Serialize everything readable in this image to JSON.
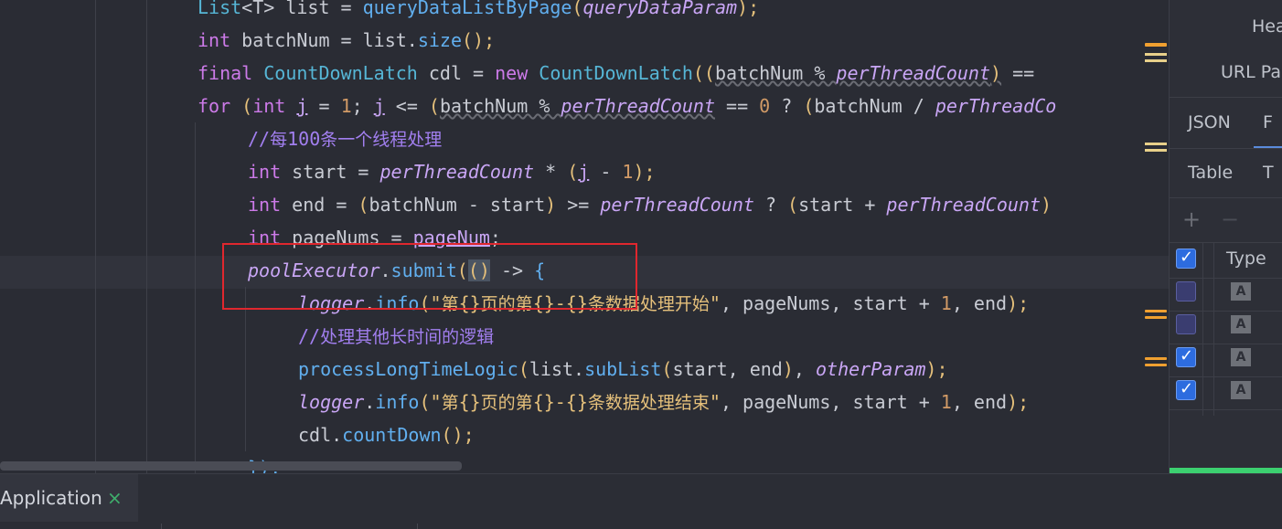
{
  "editor": {
    "lines": [
      {
        "id": "l1",
        "tokens": [
          [
            "ty",
            "List"
          ],
          [
            "vr",
            "<T> list = "
          ],
          [
            "fn",
            "queryDataListByPage"
          ],
          [
            "str",
            "("
          ],
          [
            "fld",
            "queryDataParam"
          ],
          [
            "str",
            ");"
          ]
        ]
      },
      {
        "id": "l2",
        "tokens": [
          [
            "kw",
            "int"
          ],
          [
            "vr",
            " batchNum = list."
          ],
          [
            "fn",
            "size"
          ],
          [
            "str",
            "();"
          ]
        ]
      },
      {
        "id": "l3",
        "tokens": [
          [
            "kw",
            "final "
          ],
          [
            "ty",
            "CountDownLatch"
          ],
          [
            "vr",
            " cdl = "
          ],
          [
            "kw",
            "new "
          ],
          [
            "ty",
            "CountDownLatch"
          ],
          [
            "str",
            "(("
          ],
          [
            "vr",
            "batchNum % "
          ],
          [
            "fld",
            "perThreadCount"
          ],
          [
            "str",
            ")"
          ],
          [
            "vr",
            " == "
          ]
        ]
      },
      {
        "id": "l4",
        "tokens": [
          [
            "kw",
            "for "
          ],
          [
            "str",
            "("
          ],
          [
            "kw",
            "int "
          ],
          [
            "fldu",
            "j"
          ],
          [
            "vr",
            " = "
          ],
          [
            "num",
            "1"
          ],
          [
            "vr",
            "; "
          ],
          [
            "fldu",
            "j"
          ],
          [
            "vr",
            " <= "
          ],
          [
            "str",
            "("
          ],
          [
            "vr",
            "batchNum % "
          ],
          [
            "fld",
            "perThreadCount"
          ],
          [
            "vr",
            " == "
          ],
          [
            "num",
            "0"
          ],
          [
            "vr",
            " ? "
          ],
          [
            "str",
            "("
          ],
          [
            "vr",
            "batchNum / "
          ],
          [
            "fld",
            "perThreadCo"
          ]
        ]
      },
      {
        "id": "l5",
        "tokens": [
          [
            "cm",
            "//"
          ],
          [
            "cmcn",
            "每"
          ],
          [
            "cm",
            "100"
          ],
          [
            "cmcn",
            "条一个线程处理"
          ]
        ]
      },
      {
        "id": "l6",
        "tokens": [
          [
            "kw",
            "int"
          ],
          [
            "vr",
            " start = "
          ],
          [
            "fld",
            "perThreadCount"
          ],
          [
            "vr",
            " * "
          ],
          [
            "str",
            "("
          ],
          [
            "fldu",
            "j"
          ],
          [
            "vr",
            " - "
          ],
          [
            "num",
            "1"
          ],
          [
            "str",
            ");"
          ]
        ]
      },
      {
        "id": "l7",
        "tokens": [
          [
            "kw",
            "int"
          ],
          [
            "vr",
            " end = "
          ],
          [
            "str",
            "("
          ],
          [
            "vr",
            "batchNum - start"
          ],
          [
            "str",
            ")"
          ],
          [
            "vr",
            " >= "
          ],
          [
            "fld",
            "perThreadCount"
          ],
          [
            "vr",
            " ? "
          ],
          [
            "str",
            "("
          ],
          [
            "vr",
            "start + "
          ],
          [
            "fld",
            "perThreadCount"
          ],
          [
            "str",
            ")"
          ]
        ]
      },
      {
        "id": "l8",
        "tokens": [
          [
            "kw",
            "int"
          ],
          [
            "vr",
            " pageNums = "
          ],
          [
            "fldu",
            "pageNum"
          ],
          [
            "vr",
            ";"
          ]
        ]
      },
      {
        "id": "l9",
        "tokens": [
          [
            "fld",
            "poolExecutor"
          ],
          [
            "vr",
            "."
          ],
          [
            "fn",
            "submit"
          ],
          [
            "str",
            "("
          ],
          [
            "phl",
            "()"
          ],
          [
            "vr",
            " -> "
          ],
          [
            "fn",
            "{"
          ]
        ]
      },
      {
        "id": "l10",
        "tokens": [
          [
            "fld",
            "logger"
          ],
          [
            "vr",
            "."
          ],
          [
            "fn",
            "info"
          ],
          [
            "str",
            "("
          ],
          [
            "str",
            "\"第{}页的第{}-{}条数据处理开始\""
          ],
          [
            "vr",
            ", pageNums, start + "
          ],
          [
            "num",
            "1"
          ],
          [
            "vr",
            ", end"
          ],
          [
            "str",
            ");"
          ]
        ]
      },
      {
        "id": "l11",
        "tokens": [
          [
            "cm",
            "//"
          ],
          [
            "cmcn",
            "处理其他长时间的逻辑"
          ]
        ]
      },
      {
        "id": "l12",
        "tokens": [
          [
            "fn",
            "processLongTimeLogic"
          ],
          [
            "str",
            "("
          ],
          [
            "vr",
            "list."
          ],
          [
            "fn",
            "subList"
          ],
          [
            "str",
            "("
          ],
          [
            "vr",
            "start, end"
          ],
          [
            "str",
            ")"
          ],
          [
            "vr",
            ", "
          ],
          [
            "fld",
            "otherParam"
          ],
          [
            "str",
            ");"
          ]
        ]
      },
      {
        "id": "l13",
        "tokens": [
          [
            "fld",
            "logger"
          ],
          [
            "vr",
            "."
          ],
          [
            "fn",
            "info"
          ],
          [
            "str",
            "("
          ],
          [
            "str",
            "\"第{}页的第{}-{}条数据处理结束\""
          ],
          [
            "vr",
            ", pageNums, start + "
          ],
          [
            "num",
            "1"
          ],
          [
            "vr",
            ", end"
          ],
          [
            "str",
            ");"
          ]
        ]
      },
      {
        "id": "l14",
        "tokens": [
          [
            "vr",
            "cdl."
          ],
          [
            "fn",
            "countDown"
          ],
          [
            "str",
            "();"
          ]
        ]
      },
      {
        "id": "l15",
        "tokens": [
          [
            "fn",
            "});"
          ]
        ]
      }
    ]
  },
  "right_panel": {
    "header_label": "Hea",
    "url_label": "URL Pa",
    "tab_json": "JSON",
    "tab_f": "F",
    "tab_table": "Table",
    "tab_t": "T",
    "add_glyph": "+",
    "remove_glyph": "−",
    "column_type": "Type",
    "rows": [
      {
        "checked": true,
        "badge": ""
      },
      {
        "checked": false,
        "badge": "A"
      },
      {
        "checked": false,
        "badge": "A"
      },
      {
        "checked": true,
        "badge": "A"
      },
      {
        "checked": true,
        "badge": "A"
      }
    ]
  },
  "bottom": {
    "run_tab_label": "Application",
    "run_tab_close": "×"
  },
  "colors": {
    "accent_red": "#e0272e",
    "progress_green": "#3cd070",
    "checkbox_blue": "#2d6cdf"
  }
}
